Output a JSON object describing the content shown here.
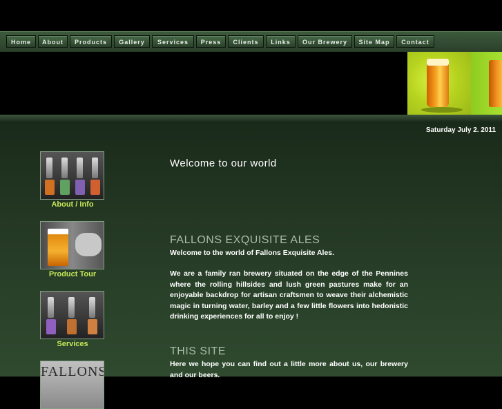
{
  "nav": {
    "items": [
      "Home",
      "About",
      "Products",
      "Gallery",
      "Services",
      "Press",
      "Clients",
      "Links",
      "Our Brewery",
      "Site Map",
      "Contact"
    ]
  },
  "date": "Saturday July 2. 2011",
  "sidebar": {
    "items": [
      {
        "label": "About / Info",
        "icon": "beer-taps-photo"
      },
      {
        "label": "Product Tour",
        "icon": "pint-glass-photo"
      },
      {
        "label": "Services",
        "icon": "beer-taps-photo"
      },
      {
        "label": "",
        "icon": "fallons-sign-photo",
        "sign_text": "FALLONS"
      }
    ]
  },
  "main": {
    "welcome_title": "Welcome to our world",
    "section1_title": "FALLONS EXQUISITE ALES",
    "section1_intro": "Welcome to the world of Fallons Exquisite Ales.",
    "section1_body": "We are a family ran brewery situated on the edge of the Pennines where the rolling hillsides and lush green pastures make for an enjoyable backdrop for artisan craftsmen to weave their alchemistic magic in turning water, barley and a few little flowers into hedonistic drinking experiences for all to enjoy !",
    "section2_title": "THIS SITE",
    "section2_body": "Here we hope you can find out a little more about us, our brewery and our beers."
  },
  "colors": {
    "nav_bg": "#2f4a2f",
    "link_green": "#c8e85a",
    "heading_grey": "#a8bca8"
  }
}
